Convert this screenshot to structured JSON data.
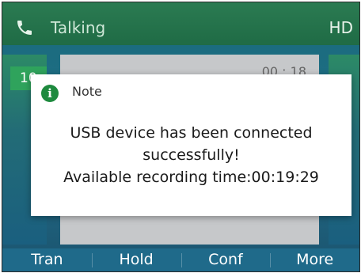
{
  "status": {
    "icon": "phone-icon",
    "text": "Talking",
    "hd_label": "HD"
  },
  "call": {
    "line_badge": "10",
    "timer": "00 : 18"
  },
  "dialog": {
    "icon": "info-icon",
    "title": "Note",
    "message_line1": "USB device has been connected",
    "message_line2": "successfully!",
    "message_line3": "Available recording time:00:19:29"
  },
  "softkeys": [
    {
      "label": "Tran"
    },
    {
      "label": "Hold"
    },
    {
      "label": "Conf"
    },
    {
      "label": "More"
    }
  ],
  "colors": {
    "status_bar": "#2b7b52",
    "softkey_bar": "#1f6a8a",
    "info_icon": "#1e8a3e"
  }
}
